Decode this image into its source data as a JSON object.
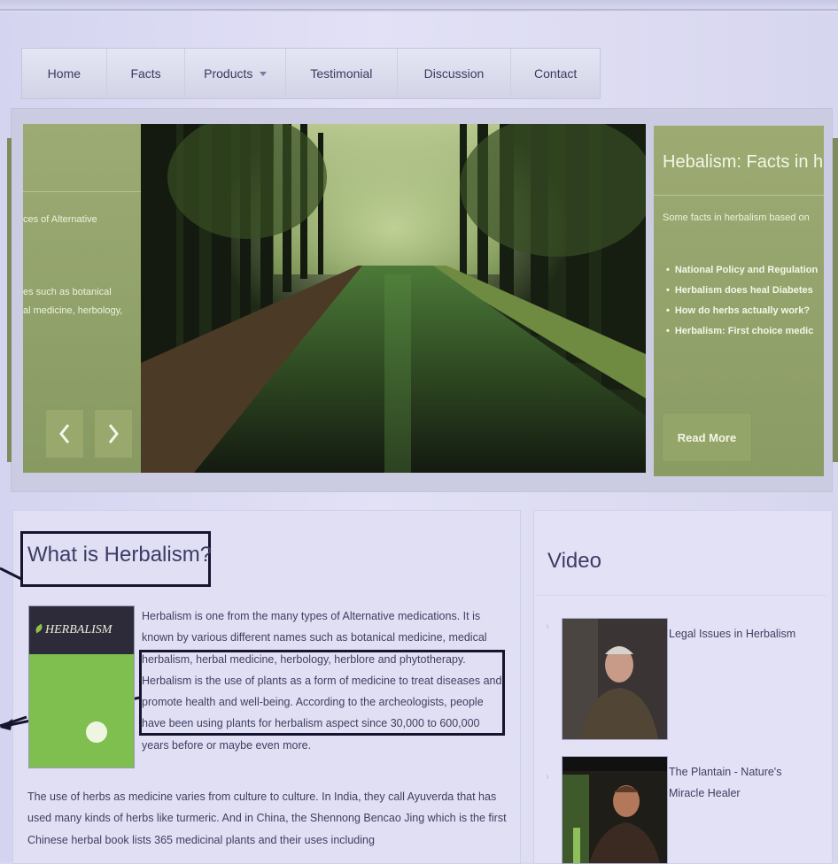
{
  "nav": {
    "items": [
      {
        "label": "Home"
      },
      {
        "label": "Facts"
      },
      {
        "label": "Products"
      },
      {
        "label": "Testimonial"
      },
      {
        "label": "Discussion"
      },
      {
        "label": "Contact"
      }
    ]
  },
  "slider": {
    "left_panel": {
      "line1": "ces of Alternative",
      "line2": "es such as botanical",
      "line3": "al medicine, herbology,"
    },
    "right_panel": {
      "title": "Hebalism: Facts in h",
      "subtitle": "Some facts in herbalism based on",
      "bullets": [
        "National Policy and Regulation",
        "Herbalism does heal Diabetes",
        "How do herbs actually work?",
        "Herbalism: First choice medic"
      ],
      "read_more": "Read More"
    },
    "prev_icon": "chevron-left-icon",
    "next_icon": "chevron-right-icon"
  },
  "article": {
    "heading": "What is Herbalism?",
    "book_title": "HERBALISM",
    "para_narrow": "Herbalism is one from the many types of Alternative medications. It is known by various different names such as botanical medicine, medical herbalism, herbal medicine, herbology, herblore and phytotherapy. Herbalism is the use of plants as a form of medicine to treat diseases and promote health and well-being. According to the archeologists, people have been using plants for herbalism aspect since 30,000 to 600,000 years before or maybe even more.",
    "para_wide": "The use of herbs as medicine varies from culture to culture. In India, they call Ayuverda that has used many kinds of herbs like turmeric. And in China, the Shennong Bencao Jing which is the first Chinese herbal book lists 365 medicinal plants and their uses including"
  },
  "video": {
    "title": "Video",
    "items": [
      {
        "label": "Legal Issues in Herbalism"
      },
      {
        "label": "The Plantain - Nature's Miracle Healer"
      }
    ]
  },
  "colors": {
    "panel_green": "#9cab73",
    "nav_text": "#3b3a61",
    "annotation": "#151530"
  }
}
